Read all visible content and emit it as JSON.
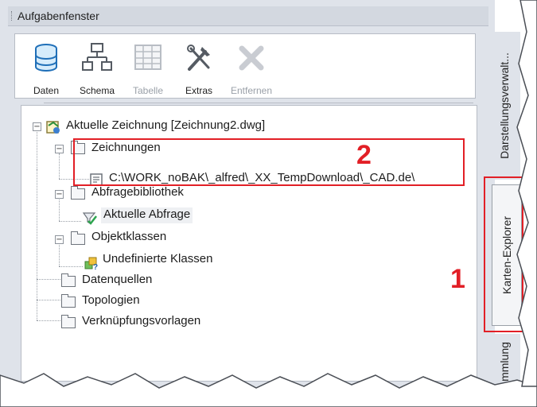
{
  "window": {
    "title": "Aufgabenfenster"
  },
  "toolbar": {
    "items": [
      {
        "label": "Daten",
        "icon": "database-icon",
        "enabled": true
      },
      {
        "label": "Schema",
        "icon": "schema-icon",
        "enabled": true
      },
      {
        "label": "Tabelle",
        "icon": "table-icon",
        "enabled": false
      },
      {
        "label": "Extras",
        "icon": "tools-icon",
        "enabled": true
      },
      {
        "label": "Entfernen",
        "icon": "remove-icon",
        "enabled": false
      }
    ]
  },
  "tree": {
    "root": "Aktuelle Zeichnung [Zeichnung2.dwg]",
    "zeichnungen": "Zeichnungen",
    "drawing_path": "C:\\WORK_noBAK\\_alfred\\_XX_TempDownload\\_CAD.de\\",
    "abfragebibliothek": "Abfragebibliothek",
    "aktuelle_abfrage": "Aktuelle Abfrage",
    "objektklassen": "Objektklassen",
    "undefinierte_klassen": "Undefinierte Klassen",
    "datenquellen": "Datenquellen",
    "topologien": "Topologien",
    "verknuepfungsvorlagen": "Verknüpfungsvorlagen"
  },
  "side_tabs": {
    "darstellung": "Darstellungsverwalt...",
    "karten_explorer": "Karten-Explorer",
    "sammlung": "mmlung"
  },
  "annotations": {
    "one": "1",
    "two": "2"
  },
  "colors": {
    "highlight": "#e21f26",
    "panel": "#dfe3ea"
  }
}
